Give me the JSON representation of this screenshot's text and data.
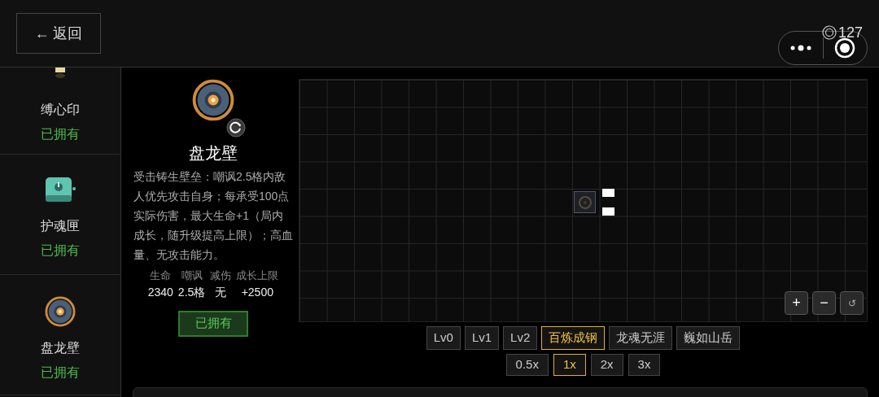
{
  "header": {
    "back_button": "← 返回",
    "coins": "127"
  },
  "sidebar": {
    "items": [
      {
        "name": "缚心印",
        "status": "已拥有",
        "owned": true
      },
      {
        "name": "护魂匣",
        "status": "已拥有",
        "owned": true
      },
      {
        "name": "盘龙壁",
        "status": "已拥有",
        "owned": true
      }
    ]
  },
  "detail": {
    "name": "盘龙壁",
    "description": "受击铸生壁垒：嘲讽2.5格内敌人优先攻击自身；每承受100点实际伤害，最大生命+1（局内成长，随升级提高上限）；高血量、无攻击能力。",
    "stats": [
      {
        "label": "生命",
        "value": "2340"
      },
      {
        "label": "嘲讽",
        "value": "2.5格"
      },
      {
        "label": "减伤",
        "value": "无"
      },
      {
        "label": "成长上限",
        "value": "+2500"
      }
    ],
    "owned_button": "已拥有"
  },
  "canvas": {
    "controls": [
      "+",
      "−",
      "↺"
    ]
  },
  "levels": [
    {
      "label": "Lv0",
      "selected": false
    },
    {
      "label": "Lv1",
      "selected": false
    },
    {
      "label": "Lv2",
      "selected": false
    },
    {
      "label": "百炼成钢",
      "selected": true
    },
    {
      "label": "龙魂无涯",
      "selected": false
    },
    {
      "label": "巍如山岳",
      "selected": false
    }
  ],
  "speeds": [
    {
      "label": "0.5x",
      "selected": false
    },
    {
      "label": "1x",
      "selected": true
    },
    {
      "label": "2x",
      "selected": false
    },
    {
      "label": "3x",
      "selected": false
    }
  ]
}
